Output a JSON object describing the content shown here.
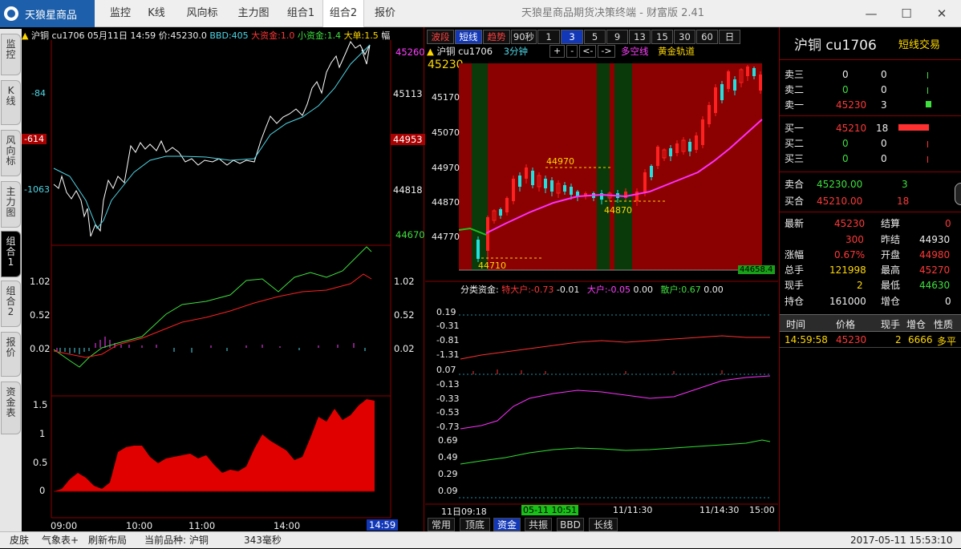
{
  "app": {
    "logo_label": "天狼星商品",
    "window_title": "天狼星商品期货决策终端 - 财富版 2.41",
    "nav_tabs": [
      "监控",
      "K线",
      "风向标",
      "主力图",
      "组合1",
      "组合2",
      "报价"
    ],
    "active_tab": "组合2",
    "window_buttons": {
      "minimize": "—",
      "maximize": "☐",
      "close": "✕"
    }
  },
  "side_tabs": [
    "监控",
    "K线",
    "风向标",
    "主力图",
    "组合1",
    "组合2",
    "报价",
    "资金表"
  ],
  "active_side_tab": "组合1",
  "left_chart": {
    "header": {
      "symbol": "沪铜",
      "code": "cu1706",
      "date": "05月11日",
      "time": "14:59",
      "price": "价:45230.0",
      "bbd": "BBD:405",
      "big": "大资金:1.0",
      "small": "小资金:1.4",
      "single": "大单:1.5",
      "cut": "幅"
    },
    "price_right": [
      "45260",
      "45113",
      "44953",
      "44818",
      "44670"
    ],
    "price_left": [
      "-84",
      "-614",
      "-1063"
    ],
    "ind1_labels": [
      "1.02",
      "0.52",
      "0.02"
    ],
    "ind1_right": [
      "1.02",
      "0.52",
      "0.02"
    ],
    "ind2_labels": [
      "1.5",
      "1",
      "0.5",
      "0"
    ],
    "time_labels": [
      "09:00",
      "10:00",
      "11:00",
      "14:00"
    ],
    "time_current": "14:59"
  },
  "mid_toolbar": {
    "buttons": [
      "波段",
      "短线",
      "趋势",
      "90秒",
      "1",
      "3",
      "5",
      "9",
      "13",
      "15",
      "30",
      "60",
      "日"
    ],
    "selected": [
      "短线",
      "3"
    ]
  },
  "kline": {
    "header_symbol": "沪铜",
    "header_code": "cu1706",
    "period": "3分钟",
    "nav_buttons": [
      "+",
      "-",
      "<-",
      "->"
    ],
    "line1": "多空线",
    "line2": "黄金轨道",
    "current_price": "45230",
    "y_labels": [
      "45170",
      "45070",
      "44970",
      "44870",
      "44770"
    ],
    "annotations": [
      "44970",
      "44870",
      "44710"
    ],
    "last_value_box": "44658.4"
  },
  "fund": {
    "title": "分类资金:",
    "special_label": "特大户:-0.73",
    "special_delta": "-0.01",
    "big_label": "大户:-0.05",
    "big_delta": "0.00",
    "retail_label": "散户:0.67",
    "retail_delta": "0.00",
    "y_labels_1": [
      "0.19",
      "-0.31",
      "-0.81",
      "-1.31"
    ],
    "y_labels_2": [
      "0.07",
      "-0.13",
      "-0.33",
      "-0.53",
      "-0.73"
    ],
    "y_labels_3": [
      "0.69",
      "0.49",
      "0.29",
      "0.09"
    ],
    "time_labels": [
      "11日09:18",
      "05-11 10:51",
      "11/11:30",
      "11/14:30",
      "15:00"
    ]
  },
  "bottom_tabs": [
    "常用",
    "顶底",
    "资金",
    "共振",
    "BBD",
    "长线"
  ],
  "active_bottom_tab": "资金",
  "quote": {
    "name": "沪铜 cu1706",
    "mode": "短线交易",
    "asks": [
      {
        "label": "卖三",
        "price": "0",
        "vol": "0"
      },
      {
        "label": "卖二",
        "price": "0",
        "vol": "0"
      },
      {
        "label": "卖一",
        "price": "45230",
        "vol": "3"
      }
    ],
    "bids": [
      {
        "label": "买一",
        "price": "45210",
        "vol": "18"
      },
      {
        "label": "买二",
        "price": "0",
        "vol": "0"
      },
      {
        "label": "买三",
        "price": "0",
        "vol": "0"
      }
    ],
    "total_ask_label": "卖合",
    "total_ask_price": "45230.00",
    "total_ask_vol": "3",
    "total_bid_label": "买合",
    "total_bid_price": "45210.00",
    "total_bid_vol": "18",
    "stats": [
      {
        "k1": "最新",
        "v1": "45230",
        "k2": "结算",
        "v2": "0"
      },
      {
        "k1": "",
        "v1": "300",
        "k2": "昨结",
        "v2": "44930"
      },
      {
        "k1": "涨幅",
        "v1": "0.67%",
        "k2": "开盘",
        "v2": "44980"
      },
      {
        "k1": "总手",
        "v1": "121998",
        "k2": "最高",
        "v2": "45270"
      },
      {
        "k1": "现手",
        "v1": "2",
        "k2": "最低",
        "v2": "44630"
      },
      {
        "k1": "持仓",
        "v1": "161000",
        "k2": "增仓",
        "v2": "0"
      }
    ],
    "trade_headers": [
      "时间",
      "价格",
      "现手",
      "增仓",
      "性质"
    ],
    "trades": [
      {
        "time": "14:59:58",
        "price": "45230",
        "vol": "2",
        "oi": "6666",
        "type": "多平"
      }
    ]
  },
  "statusbar": {
    "skin": "皮肤",
    "weather": "气象表+",
    "refresh": "刷新布局",
    "current": "当前品种: 沪铜",
    "ms": "343毫秒",
    "datetime": "2017-05-11 15:53:10"
  },
  "colors": {
    "up": "#ff2020",
    "down": "#20e0e0",
    "accent": "#1238b8",
    "pane_red": "#8b0000",
    "pane_green": "#0a3a0a"
  }
}
